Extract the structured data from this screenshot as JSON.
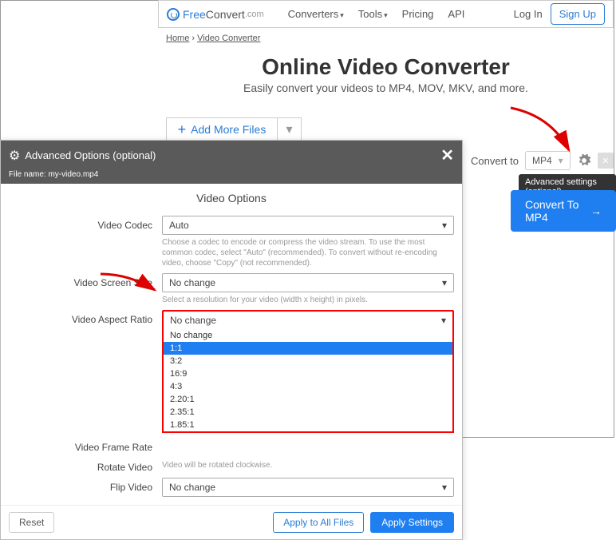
{
  "brand": {
    "free": "Free",
    "convert": "Convert",
    "com": ".com"
  },
  "nav": {
    "converters": "Converters",
    "tools": "Tools",
    "pricing": "Pricing",
    "api": "API",
    "login": "Log In",
    "signup": "Sign Up"
  },
  "crumbs": {
    "home": "Home",
    "sep": "›",
    "video": "Video Converter"
  },
  "hero": {
    "title": "Online Video Converter",
    "sub": "Easily convert your videos to MP4, MOV, MKV, and more."
  },
  "addmore": "Add More Files",
  "convert": {
    "label": "Convert to",
    "format": "MP4",
    "tooltip": "Advanced settings (optional)",
    "button": "Convert To MP4"
  },
  "modal": {
    "title": "Advanced Options (optional)",
    "filename_label": "File name:",
    "filename": "my-video.mp4",
    "section": "Video Options",
    "fields": {
      "codec": {
        "label": "Video Codec",
        "value": "Auto",
        "help": "Choose a codec to encode or compress the video stream. To use the most common codec, select \"Auto\" (recommended). To convert without re-encoding video, choose \"Copy\" (not recommended)."
      },
      "screen": {
        "label": "Video Screen Size",
        "value": "No change",
        "help": "Select a resolution for your video (width x height) in pixels."
      },
      "aspect": {
        "label": "Video Aspect Ratio",
        "value": "No change",
        "options": [
          "No change",
          "1:1",
          "3:2",
          "16:9",
          "4:3",
          "2.20:1",
          "2.35:1",
          "1.85:1"
        ]
      },
      "fps": {
        "label": "Video Frame Rate"
      },
      "rotate": {
        "label": "Rotate Video",
        "help": "Video will be rotated clockwise."
      },
      "flip": {
        "label": "Flip Video",
        "value": "No change"
      }
    },
    "buttons": {
      "reset": "Reset",
      "all": "Apply to All Files",
      "apply": "Apply Settings"
    }
  }
}
